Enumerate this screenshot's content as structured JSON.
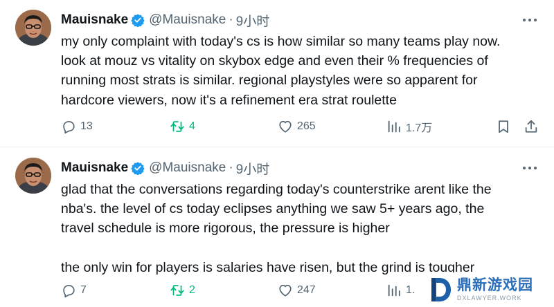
{
  "tweets": [
    {
      "display_name": "Mauisnake",
      "handle": "@Mauisnake",
      "separator": "·",
      "time": "9小时",
      "body": "my only complaint with today's cs is how similar so many teams play now.\nlook at mouz vs vitality on skybox edge and even their % frequencies of\nrunning most strats is similar. regional playstyles were so apparent for\nhardcore viewers, now it's a refinement era strat roulette",
      "replies": "13",
      "retweets": "4",
      "likes": "265",
      "views": "1.7万"
    },
    {
      "display_name": "Mauisnake",
      "handle": "@Mauisnake",
      "separator": "·",
      "time": "9小时",
      "body": "glad that the conversations regarding today's counterstrike arent like the\nnba's. the level of cs today eclipses anything we saw 5+ years ago, the\ntravel schedule is more rigorous, the pressure is higher\n\nthe only win for players is salaries have risen, but the grind is tougher",
      "replies": "7",
      "retweets": "2",
      "likes": "247",
      "views": "1."
    }
  ],
  "icons": {
    "verified": "verified-badge-icon",
    "more": "more-options-icon",
    "reply": "reply-icon",
    "retweet": "retweet-icon",
    "like": "heart-icon",
    "views": "analytics-icon",
    "bookmark": "bookmark-icon",
    "share": "share-icon"
  },
  "colors": {
    "text": "#0f1419",
    "secondary": "#536471",
    "verified": "#1d9bf0",
    "retweet_active": "#00ba7c",
    "divider": "#eff3f4"
  },
  "watermark": {
    "title": "鼎新游戏园",
    "subtitle": "DXLAWYER.WORK"
  }
}
